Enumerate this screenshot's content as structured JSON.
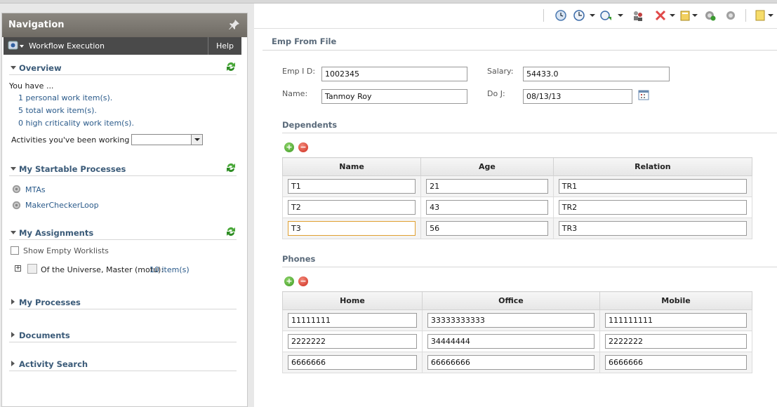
{
  "nav": {
    "title": "Navigation",
    "workflow_label": "Workflow Execution",
    "help_label": "Help",
    "overview": {
      "title": "Overview",
      "you_have": "You have ...",
      "links": [
        "1 personal work item(s).",
        "5 total work item(s).",
        "0 high criticality work item(s)."
      ],
      "activities_label": "Activities you've been working on:",
      "activities_value": ""
    },
    "startable": {
      "title": "My Startable Processes",
      "items": [
        "MTAs",
        "MakerCheckerLoop"
      ]
    },
    "assignments": {
      "title": "My Assignments",
      "show_empty_label": "Show Empty Worklists",
      "user_label": "Of the Universe, Master (motu):",
      "user_items": "10 item(s)"
    },
    "processes": {
      "title": "My Processes"
    },
    "documents": {
      "title": "Documents"
    },
    "activity_search": {
      "title": "Activity Search"
    }
  },
  "form": {
    "title": "Emp From File",
    "emp_id_label": "Emp I D:",
    "emp_id_value": "1002345",
    "salary_label": "Salary:",
    "salary_value": "54433.0",
    "name_label": "Name:",
    "name_value": "Tanmoy Roy",
    "doj_label": "Do J:",
    "doj_value": "08/13/13",
    "dependents": {
      "title": "Dependents",
      "headers": [
        "Name",
        "Age",
        "Relation"
      ],
      "rows": [
        [
          "T1",
          "21",
          "TR1"
        ],
        [
          "T2",
          "43",
          "TR2"
        ],
        [
          "T3",
          "56",
          "TR3"
        ]
      ]
    },
    "phones": {
      "title": "Phones",
      "headers": [
        "Home",
        "Office",
        "Mobile"
      ],
      "rows": [
        [
          "11111111",
          "33333333333",
          "111111111"
        ],
        [
          "2222222",
          "34444444",
          "2222222"
        ],
        [
          "6666666",
          "66666666",
          "6666666"
        ]
      ]
    }
  },
  "colors": {
    "accent": "#3a5a78",
    "link": "#2a5a8a",
    "header": "#6f6b64"
  }
}
